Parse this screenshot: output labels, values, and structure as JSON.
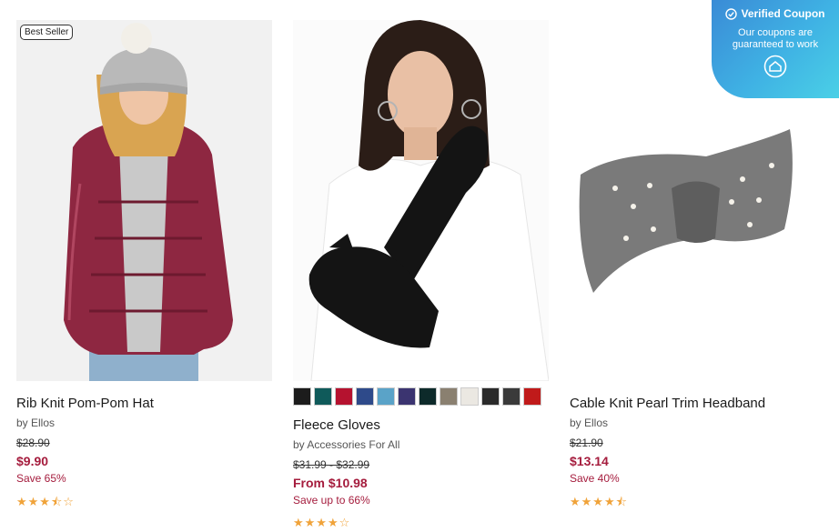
{
  "products": [
    {
      "badge": "Best Seller",
      "title": "Rib Knit Pom-Pom Hat",
      "brand": "by Ellos",
      "original_price": "$28.90",
      "price": "$9.90",
      "save": "Save 65%",
      "rating_stars": "★★★⯪☆",
      "rating": 3.5
    },
    {
      "title": "Fleece Gloves",
      "brand": "by Accessories For All",
      "original_price": "$31.99 - $32.99",
      "price": "From $10.98",
      "save": "Save up to 66%",
      "rating_stars": "★★★★☆",
      "rating": 4,
      "swatch_colors": [
        "#1c1c1c",
        "#0f5a5a",
        "#b5122f",
        "#2e4a8a",
        "#5aa3c8",
        "#3b3470",
        "#0d2a2a",
        "#8a8070",
        "#ebe8e2",
        "#2a2a2a",
        "#3a3a3a",
        "#c01a1a"
      ]
    },
    {
      "title": "Cable Knit Pearl Trim Headband",
      "brand": "by Ellos",
      "original_price": "$21.90",
      "price": "$13.14",
      "save": "Save 40%",
      "rating_stars": "★★★★⯪",
      "rating": 4.5
    }
  ],
  "coupon": {
    "title": "Verified Coupon",
    "text": "Our coupons are guaranteed to work"
  },
  "colors": {
    "price": "#a51c3d",
    "star": "#f0a33a",
    "coupon_gradient_start": "#3a8bd6",
    "coupon_gradient_end": "#4ad0e6"
  }
}
